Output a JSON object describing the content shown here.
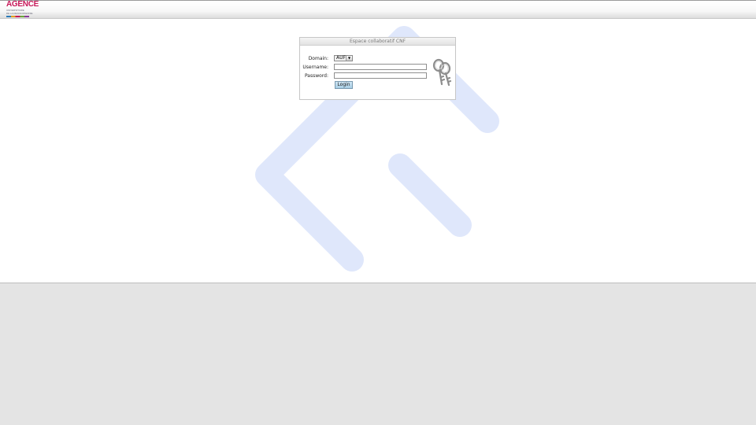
{
  "header": {
    "logo": {
      "word": "AGENCE",
      "line1": "UNIVERSITAIRE",
      "line2": "DE LA FRANCOPHONIE"
    }
  },
  "login": {
    "title": "Espace collaboratif CNF",
    "domain_label": "Domain:",
    "domain_value": "AUF",
    "username_label": "Username:",
    "password_label": "Password:",
    "login_button": "Login"
  },
  "icons": {
    "keys": "keys-icon",
    "dropdown": "chevron-down-icon"
  },
  "colors": {
    "watermark": "#dfe7fb",
    "button": "#b9dbf0",
    "brand": "#c8195a"
  }
}
